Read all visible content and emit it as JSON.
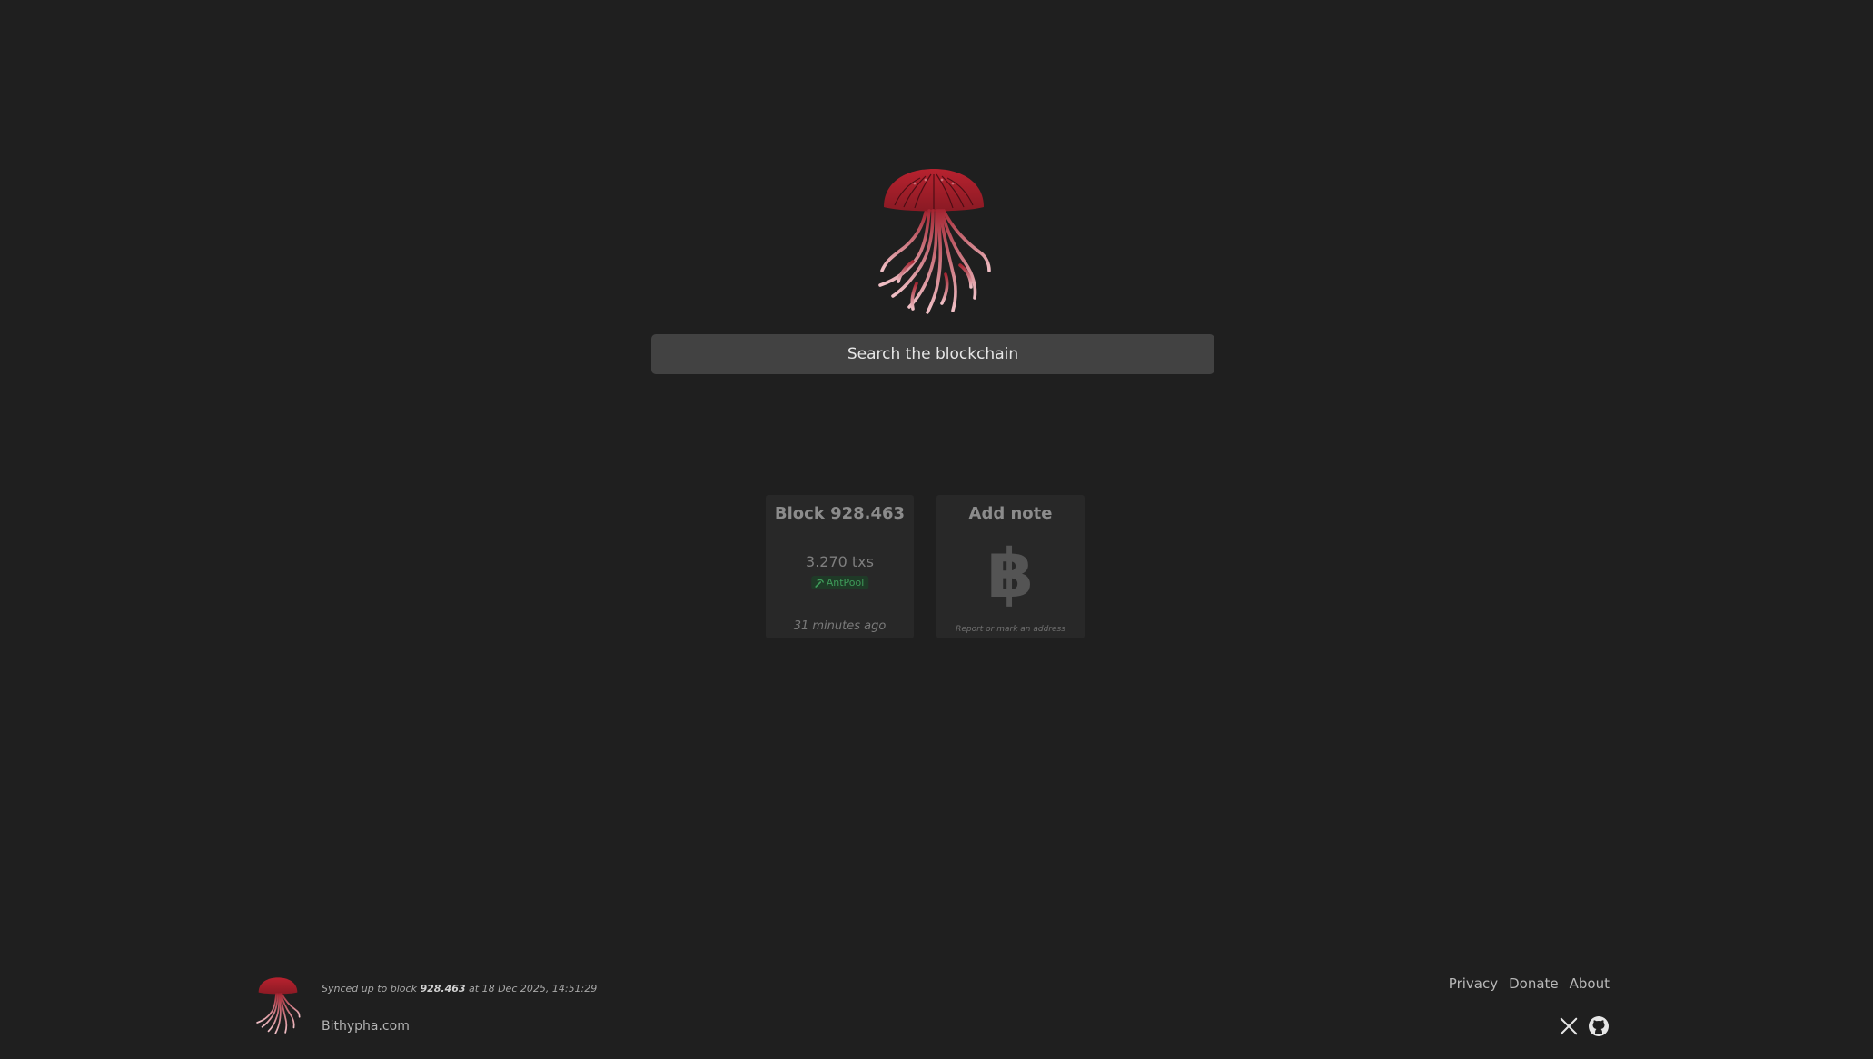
{
  "search": {
    "placeholder": "Search the blockchain"
  },
  "cards": {
    "block": {
      "title": "Block 928.463",
      "txs": "3.270 txs",
      "pool": "AntPool",
      "time": "31 minutes ago"
    },
    "note": {
      "title": "Add note",
      "icon": "bitcoin-icon",
      "subtitle": "Report or mark an address"
    }
  },
  "footer": {
    "sync_prefix": "Synced up to block",
    "sync_block": "928.463",
    "sync_suffix": "at 18 Dec 2025, 14:51:29",
    "site": "Bithypha.com",
    "links": [
      "Privacy",
      "Donate",
      "About"
    ],
    "icons": [
      "x-icon",
      "github-icon"
    ]
  },
  "colors": {
    "background": "#1f1f1f",
    "accent_red": "#b3202f",
    "pool_green": "#3f9b5a"
  }
}
